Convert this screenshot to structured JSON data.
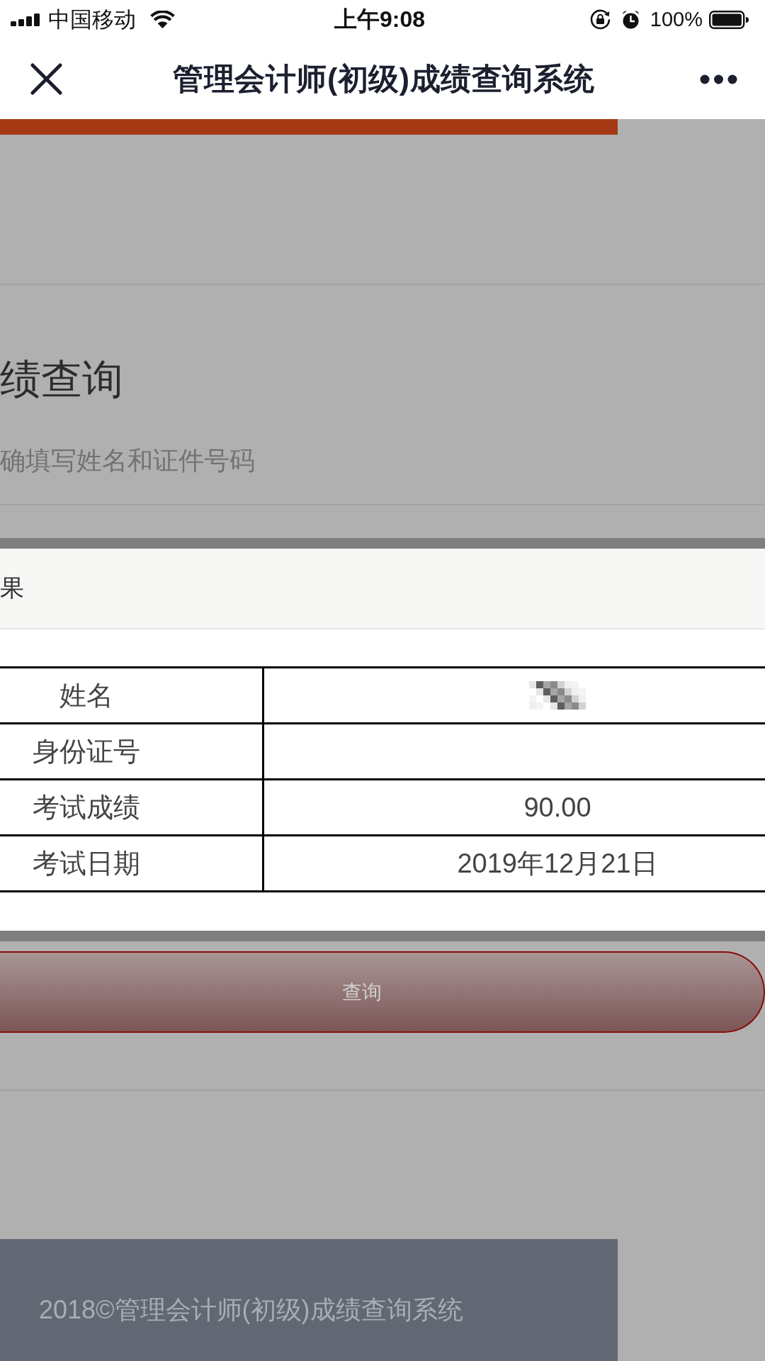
{
  "status_bar": {
    "carrier": "中国移动",
    "time": "上午9:08",
    "battery": "100%"
  },
  "nav_bar": {
    "title": "管理会计师(初级)成绩查询系统"
  },
  "page_top": {
    "heading": "绩查询",
    "subtitle": "确填写姓名和证件号码"
  },
  "result_panel": {
    "title": "果",
    "rows": [
      {
        "label": "姓名",
        "mosaic": true
      },
      {
        "label": "身份证号",
        "mosaic": false
      },
      {
        "label": "考试成绩",
        "value": "90.00",
        "mosaic": false
      },
      {
        "label": "考试日期",
        "value": "2019年12月21日",
        "mosaic": false
      }
    ]
  },
  "page_bottom": {
    "button": {
      "label": "查询"
    },
    "footer": "2018©管理会计师(初级)成绩查询系统"
  }
}
